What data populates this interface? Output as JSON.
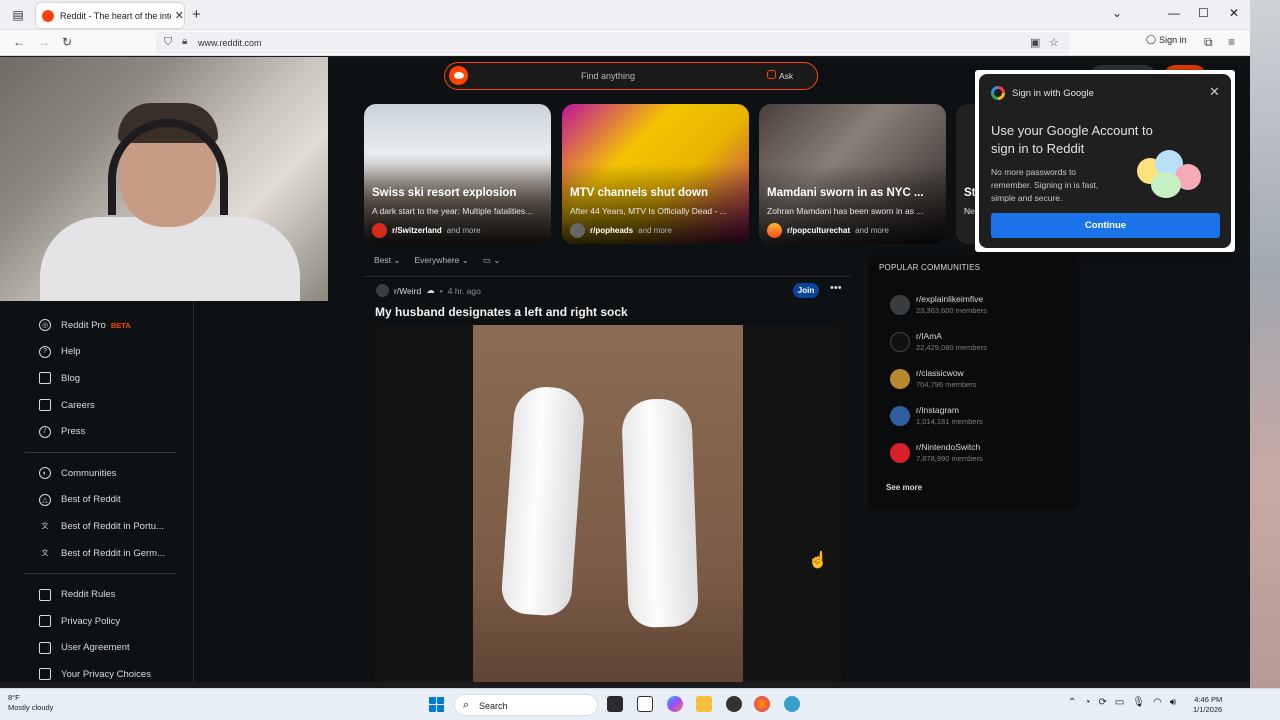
{
  "browser": {
    "tab_title": "Reddit - The heart of the internet",
    "url": "www.reddit.com",
    "signin_label": "Sign in"
  },
  "header": {
    "search_placeholder": "Find anything",
    "ask_label": "Ask"
  },
  "trending": [
    {
      "headline": "Swiss ski resort explosion",
      "sub": "A dark start to the year: Multiple fatalities...",
      "community": "r/Switzerland",
      "more": "and more",
      "color": "#dfe3e8"
    },
    {
      "headline": "MTV channels shut down",
      "sub": "After 44 Years, MTV Is Officially Dead - ...",
      "community": "r/popheads",
      "more": "and more",
      "color": "#c9168c"
    },
    {
      "headline": "Mamdani sworn in as NYC ...",
      "sub": "Zohran Mamdani has been sworn in as ...",
      "community": "r/popculturechat",
      "more": "and more",
      "color": "#3b3533"
    },
    {
      "headline": "St",
      "sub": "Ne",
      "community": "",
      "more": "",
      "color": "#222"
    }
  ],
  "feed_controls": {
    "sort": "Best",
    "scope": "Everywhere",
    "view": "▭"
  },
  "post": {
    "community": "r/Weird",
    "time": "4 hr. ago",
    "join_label": "Join",
    "title": "My husband designates a left and right sock"
  },
  "sidebar": {
    "items": [
      {
        "label": "Reddit Pro",
        "badge": "BETA",
        "icon": "pro-icon"
      },
      {
        "label": "Help",
        "icon": "help-icon"
      },
      {
        "label": "Blog",
        "icon": "book-icon"
      },
      {
        "label": "Careers",
        "icon": "briefcase-icon"
      },
      {
        "label": "Press",
        "icon": "mic-icon"
      },
      {
        "label": "Communities",
        "icon": "communities-icon"
      },
      {
        "label": "Best of Reddit",
        "icon": "star-icon"
      },
      {
        "label": "Best of Reddit in Portu...",
        "icon": "translate-icon"
      },
      {
        "label": "Best of Reddit in Germ...",
        "icon": "translate-icon"
      },
      {
        "label": "Reddit Rules",
        "icon": "book-icon"
      },
      {
        "label": "Privacy Policy",
        "icon": "book-icon"
      },
      {
        "label": "User Agreement",
        "icon": "book-icon"
      },
      {
        "label": "Your Privacy Choices",
        "icon": "book-icon"
      }
    ]
  },
  "popular": {
    "heading": "POPULAR COMMUNITIES",
    "items": [
      {
        "name": "r/explainlikeimfive",
        "members": "23,363,600 members",
        "color": "#3a3d40"
      },
      {
        "name": "r/IAmA",
        "members": "22,429,080 members",
        "color": "#111"
      },
      {
        "name": "r/classicwow",
        "members": "704,796 members",
        "color": "#b8892a"
      },
      {
        "name": "r/Instagram",
        "members": "1,014,181 members",
        "color": "#2e5f9e"
      },
      {
        "name": "r/NintendoSwitch",
        "members": "7,878,990 members",
        "color": "#d8202a"
      }
    ],
    "see_more": "See more"
  },
  "google_popup": {
    "title": "Sign in with Google",
    "heading": "Use your Google Account to sign in to Reddit",
    "body": "No more passwords to remember. Signing in is fast, simple and secure.",
    "button": "Continue"
  },
  "taskbar": {
    "temp": "8°F",
    "weather": "Mostly cloudy",
    "search": "Search",
    "time": "4:46 PM",
    "date": "1/1/2026"
  }
}
